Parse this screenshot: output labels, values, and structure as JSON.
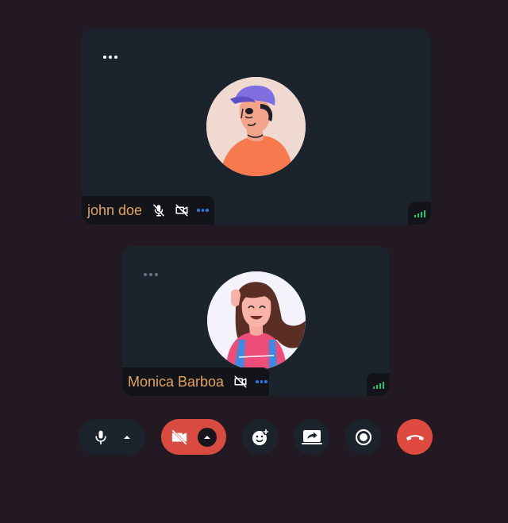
{
  "participants": [
    {
      "name": "john doe",
      "mic": "mic-muted-icon",
      "camera": "camera-off-icon",
      "avatar": "illustrated-man-with-cap",
      "signal": "signal-strength-icon"
    },
    {
      "name": "Monica Barboa",
      "camera": "camera-off-icon",
      "avatar": "illustrated-woman-waving",
      "signal": "signal-strength-icon"
    }
  ],
  "controls": [
    {
      "id": "microphone",
      "icon": "microphone-icon",
      "extra": "chevron-up-icon"
    },
    {
      "id": "camera",
      "icon": "camera-off-icon",
      "extra": "chevron-up-icon",
      "state": "off"
    },
    {
      "id": "reactions",
      "icon": "emoji-add-icon"
    },
    {
      "id": "share-screen",
      "icon": "screen-share-icon"
    },
    {
      "id": "record",
      "icon": "record-icon"
    },
    {
      "id": "end-call",
      "icon": "phone-hangup-icon"
    }
  ],
  "colors": {
    "background": "#231923",
    "tile": "#1b232d",
    "name_bar": "#121419",
    "name_text": "#e2a25b",
    "accent_blue": "#2a79e8",
    "danger": "#d94a40",
    "signal_green": "#21c46b"
  }
}
